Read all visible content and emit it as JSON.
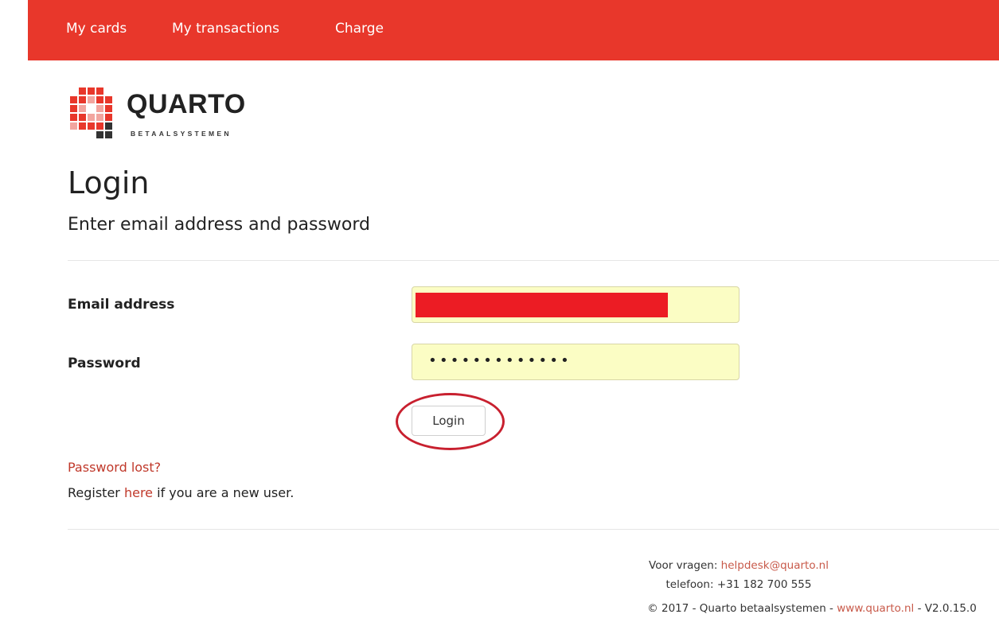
{
  "nav": {
    "items": [
      {
        "label": "My cards"
      },
      {
        "label": "My transactions"
      },
      {
        "label": "Charge"
      }
    ],
    "background_color": "#e8372b"
  },
  "logo": {
    "word": "QUARTO",
    "subtitle": "BETAALSYSTEMEN",
    "icon": "quarto-q-logo"
  },
  "page": {
    "title": "Login",
    "subtitle": "Enter email address and password"
  },
  "form": {
    "email_label": "Email address",
    "email_value_redacted": true,
    "password_label": "Password",
    "password_mask": "•••••••••••••",
    "login_button": "Login"
  },
  "links": {
    "password_lost": "Password lost?",
    "register_prefix": "Register ",
    "register_link": "here",
    "register_suffix": " if you are a new user."
  },
  "footer": {
    "questions_prefix": "Voor vragen: ",
    "helpdesk_email": "helpdesk@quarto.nl",
    "phone": "telefoon: +31 182 700 555",
    "copyright_prefix": "© 2017 - Quarto betaalsystemen - ",
    "website": "www.quarto.nl",
    "version": " - V2.0.15.0"
  },
  "colors": {
    "accent": "#e8372b",
    "link": "#c0392b",
    "input_autofill": "#fbfdc4",
    "annotation_circle": "#c8202f",
    "redaction": "#ec1c24"
  }
}
